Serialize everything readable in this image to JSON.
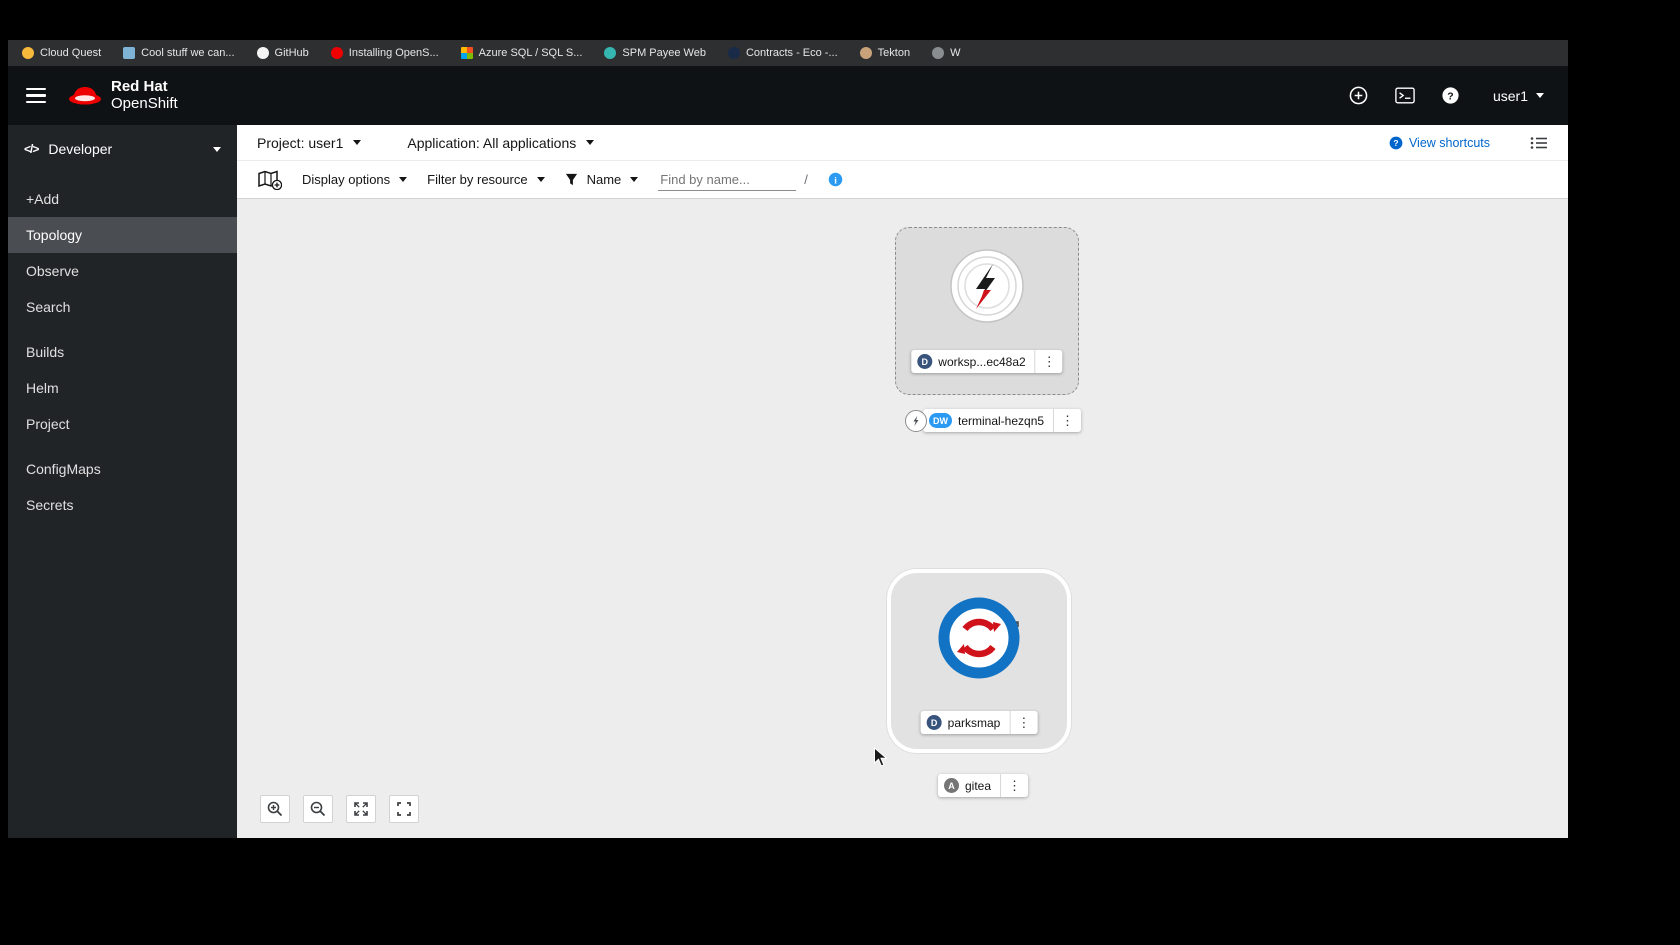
{
  "colors": {
    "masthead_bg": "#0f1214",
    "bookmarks_bg": "#2d2f31",
    "sidebar_bg": "#212427",
    "sidebar_active": "#4a4e52",
    "canvas_bg": "#ededed",
    "link_blue": "#0066cc",
    "info_blue": "#2b9af3",
    "badge_d": "#38547c",
    "badge_dw": "#2b9af3",
    "badge_a": "#757575",
    "brand_red": "#ee0000",
    "parksmap_blue": "#1273c4",
    "parksmap_red": "#d0121b"
  },
  "bookmarks": {
    "items": [
      {
        "label": "Cloud Quest",
        "icon": "cloud-quest-favicon"
      },
      {
        "label": "Cool stuff we can...",
        "icon": "monitor-favicon"
      },
      {
        "label": "GitHub",
        "icon": "github-favicon"
      },
      {
        "label": "Installing OpenS...",
        "icon": "openshift-favicon"
      },
      {
        "label": "Azure SQL / SQL S...",
        "icon": "grid-favicon"
      },
      {
        "label": "SPM Payee Web",
        "icon": "swirl-favicon"
      },
      {
        "label": "Contracts - Eco -...",
        "icon": "contracts-favicon"
      },
      {
        "label": "Tekton",
        "icon": "tekton-favicon"
      },
      {
        "label": "W",
        "icon": "globe-favicon"
      }
    ]
  },
  "masthead": {
    "brand_line1": "Red Hat",
    "brand_line2": "OpenShift",
    "username": "user1"
  },
  "sidebar": {
    "perspective": "Developer",
    "items": [
      {
        "label": "+Add",
        "active": false
      },
      {
        "label": "Topology",
        "active": true
      },
      {
        "label": "Observe",
        "active": false
      },
      {
        "label": "Search",
        "active": false
      },
      {
        "label": "Builds",
        "active": false
      },
      {
        "label": "Helm",
        "active": false
      },
      {
        "label": "Project",
        "active": false
      },
      {
        "label": "ConfigMaps",
        "active": false
      },
      {
        "label": "Secrets",
        "active": false
      }
    ]
  },
  "context_bar": {
    "project": "Project: user1",
    "application": "Application: All applications",
    "view_shortcuts": "View shortcuts"
  },
  "toolbar": {
    "display_options": "Display options",
    "filter_by_resource": "Filter by resource",
    "name_filter": "Name",
    "find_placeholder": "Find by name...",
    "shortcut_hint": "/"
  },
  "topology": {
    "workspace": {
      "label": "worksp...ec48a2",
      "badge": "D"
    },
    "terminal": {
      "label": "terminal-hezqn5",
      "badge": "DW"
    },
    "parksmap": {
      "label": "parksmap",
      "badge": "D"
    },
    "gitea": {
      "label": "gitea",
      "badge": "A"
    },
    "kebab_glyph": "⋮"
  }
}
